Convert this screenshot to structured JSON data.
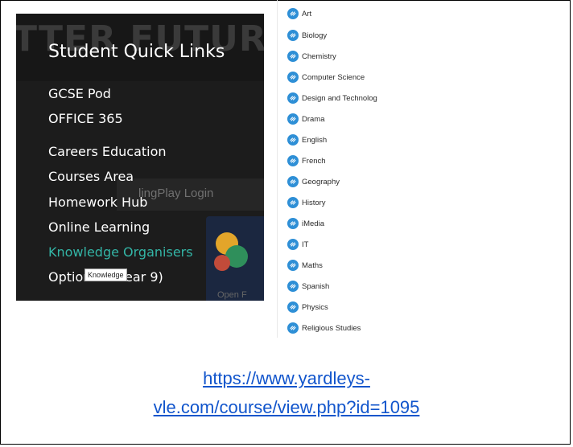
{
  "left_panel": {
    "watermark": "TTER FUTURE",
    "title": "Student Quick Links",
    "ghost_button": "lingPlay Login",
    "ghost_open": "Open F",
    "links": [
      {
        "label": "GCSE Pod",
        "active": false
      },
      {
        "label": "OFFICE 365",
        "active": false
      },
      {
        "label": "Careers Education",
        "active": false
      },
      {
        "label": "Courses Area",
        "active": false
      },
      {
        "label": "Homework Hub",
        "active": false
      },
      {
        "label": "Online Learning",
        "active": false
      },
      {
        "label": "Knowledge Organisers",
        "active": true
      },
      {
        "label": "Options 2",
        "active": false
      },
      {
        "label": "ear 9)",
        "active": false
      }
    ],
    "tooltip": "Knowledge",
    "accent_color": "#33b5a6"
  },
  "subjects": {
    "icon": "link-icon",
    "items": [
      "Art",
      "Biology",
      "Chemistry",
      "Computer Science",
      "Design and Technolog",
      "Drama",
      "English",
      "French",
      "Geography",
      "History",
      "iMedia",
      "IT",
      "Maths",
      "Spanish",
      "Physics",
      "Religious Studies"
    ]
  },
  "url": {
    "line1": "https://www.yardleys-",
    "line2": "vle.com/course/view.php?id=1095"
  }
}
